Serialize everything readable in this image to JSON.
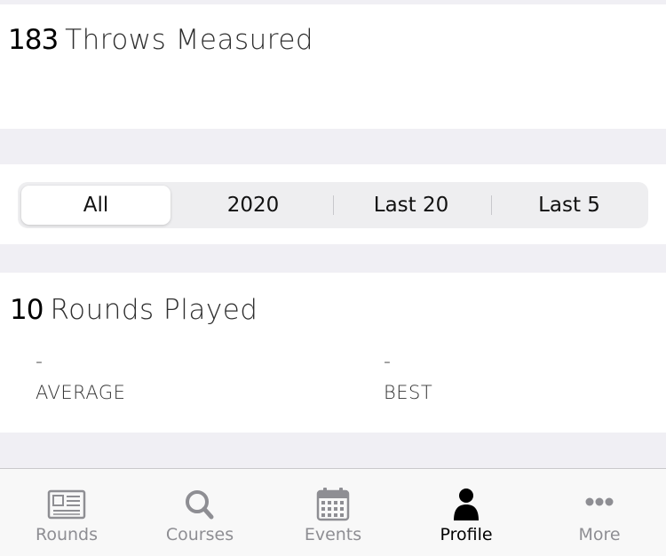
{
  "throws": {
    "count": "183",
    "label": "Throws Measured"
  },
  "filter": {
    "options": [
      "All",
      "2020",
      "Last 20",
      "Last 5"
    ],
    "selected": "All"
  },
  "rounds": {
    "count": "10",
    "label": "Rounds Played",
    "average": {
      "value": "-",
      "label": "AVERAGE"
    },
    "best": {
      "value": "-",
      "label": "BEST"
    }
  },
  "tabbar": {
    "tabs": [
      {
        "label": "Rounds",
        "icon": "newspaper-icon"
      },
      {
        "label": "Courses",
        "icon": "search-icon"
      },
      {
        "label": "Events",
        "icon": "calendar-icon"
      },
      {
        "label": "Profile",
        "icon": "person-icon"
      },
      {
        "label": "More",
        "icon": "ellipsis-icon"
      }
    ],
    "active": "Profile"
  },
  "colors": {
    "background": "#f0eff4",
    "card": "#ffffff",
    "segmented_track": "#eeeef0",
    "tab_inactive": "#8e8e93",
    "tab_active": "#000000"
  }
}
